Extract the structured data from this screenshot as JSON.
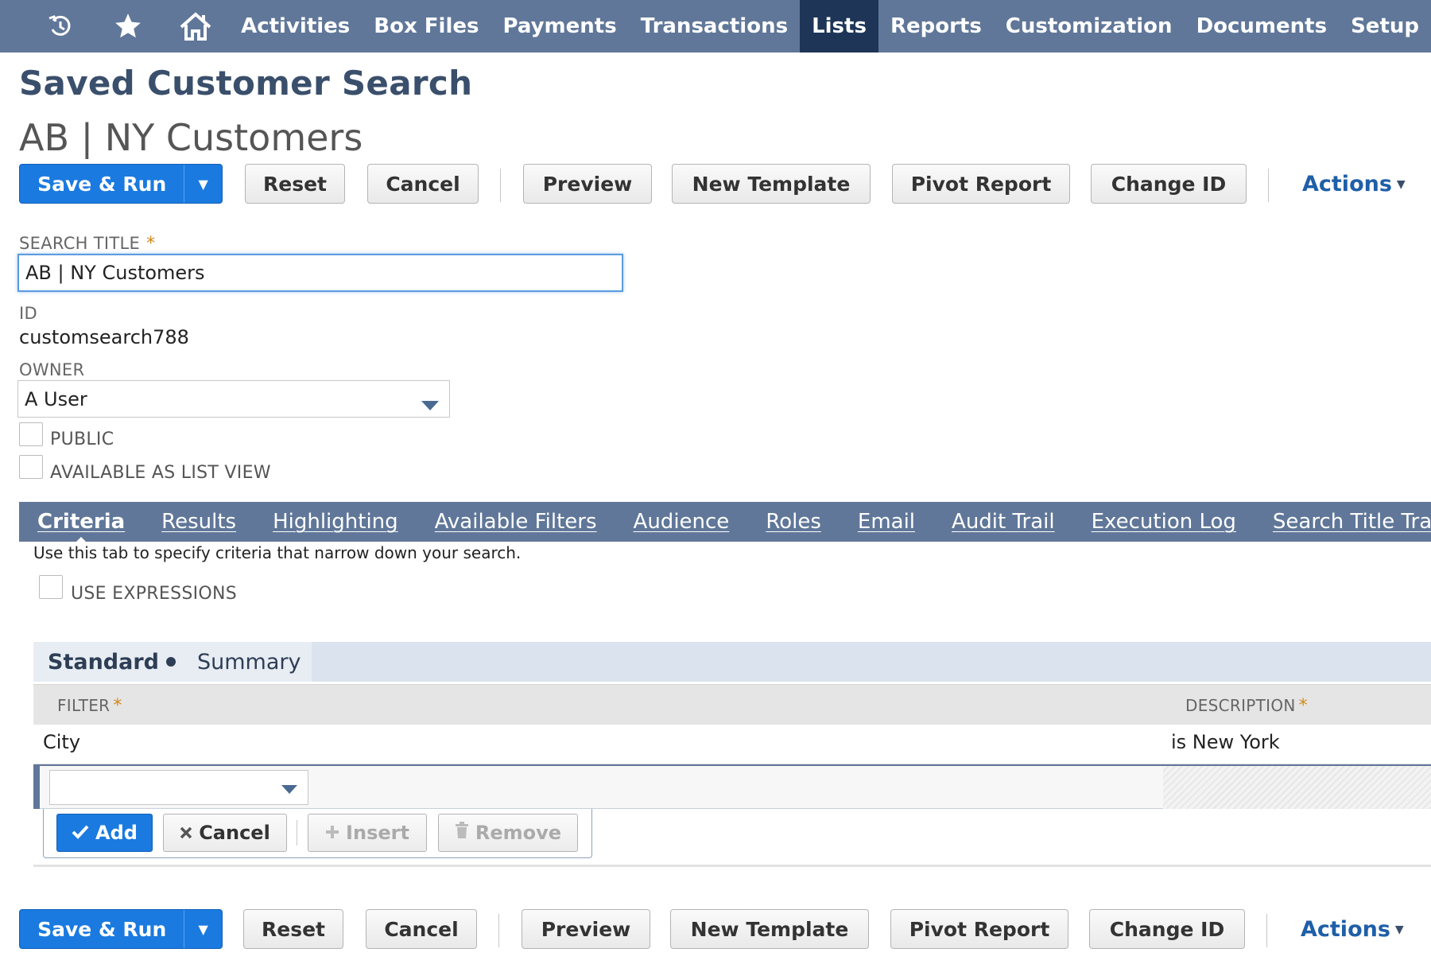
{
  "nav": {
    "icons": [
      "recent-history-icon",
      "star-icon",
      "home-icon"
    ],
    "items": [
      "Activities",
      "Box Files",
      "Payments",
      "Transactions",
      "Lists",
      "Reports",
      "Customization",
      "Documents",
      "Setup"
    ],
    "active": "Lists"
  },
  "page": {
    "title": "Saved Customer Search",
    "record_name": "AB | NY Customers"
  },
  "toolbar": {
    "save_run": "Save & Run",
    "reset": "Reset",
    "cancel": "Cancel",
    "preview": "Preview",
    "new_template": "New Template",
    "pivot_report": "Pivot Report",
    "change_id": "Change ID",
    "actions": "Actions"
  },
  "form": {
    "search_title_label": "SEARCH TITLE",
    "required_mark": "*",
    "search_title_value": "AB | NY Customers",
    "id_label": "ID",
    "id_value": "customsearch788",
    "owner_label": "OWNER",
    "owner_value": "A User",
    "public_label": "PUBLIC",
    "list_view_label": "AVAILABLE AS LIST VIEW"
  },
  "tabs": {
    "items": [
      "Criteria",
      "Results",
      "Highlighting",
      "Available Filters",
      "Audience",
      "Roles",
      "Email",
      "Audit Trail",
      "Execution Log",
      "Search Title Tran"
    ],
    "active": "Criteria"
  },
  "criteria": {
    "help_text": "Use this tab to specify criteria that narrow down your search.",
    "use_expressions_label": "USE EXPRESSIONS",
    "subtabs": {
      "standard": "Standard",
      "summary": "Summary"
    },
    "columns": {
      "filter": "FILTER",
      "description": "DESCRIPTION"
    },
    "rows": [
      {
        "filter": "City",
        "description": "is New York"
      }
    ],
    "line_buttons": {
      "add": "Add",
      "cancel": "Cancel",
      "insert": "Insert",
      "remove": "Remove"
    }
  },
  "colors": {
    "nav_bg": "#607799",
    "nav_active": "#1e3557",
    "primary": "#1a7ae0",
    "required": "#d08a1b",
    "link": "#1f5fa8"
  }
}
